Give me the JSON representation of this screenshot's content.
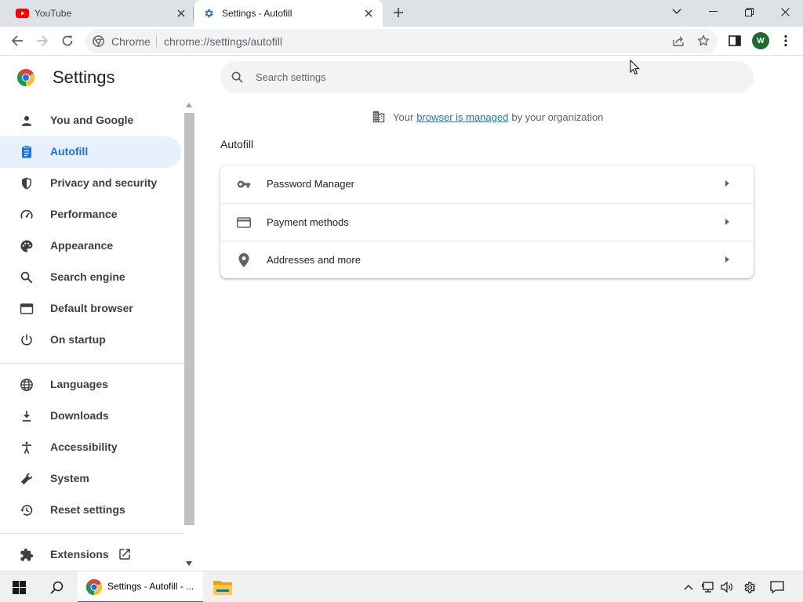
{
  "tabs": [
    {
      "title": "YouTube",
      "icon": "youtube-icon"
    },
    {
      "title": "Settings - Autofill",
      "icon": "gear-icon"
    }
  ],
  "toolbar": {
    "site_label": "Chrome",
    "url": "chrome://settings/autofill",
    "avatar_initial": "W"
  },
  "header": {
    "title": "Settings",
    "search_placeholder": "Search settings"
  },
  "sidebar": {
    "items": [
      {
        "label": "You and Google",
        "icon": "person-icon"
      },
      {
        "label": "Autofill",
        "icon": "clipboard-icon",
        "active": true
      },
      {
        "label": "Privacy and security",
        "icon": "shield-icon"
      },
      {
        "label": "Performance",
        "icon": "speedometer-icon"
      },
      {
        "label": "Appearance",
        "icon": "palette-icon"
      },
      {
        "label": "Search engine",
        "icon": "search-icon"
      },
      {
        "label": "Default browser",
        "icon": "browser-window-icon"
      },
      {
        "label": "On startup",
        "icon": "power-icon"
      },
      {
        "label": "Languages",
        "icon": "globe-icon"
      },
      {
        "label": "Downloads",
        "icon": "download-icon"
      },
      {
        "label": "Accessibility",
        "icon": "accessibility-icon"
      },
      {
        "label": "System",
        "icon": "wrench-icon"
      },
      {
        "label": "Reset settings",
        "icon": "history-icon"
      },
      {
        "label": "Extensions",
        "icon": "puzzle-icon"
      }
    ]
  },
  "main": {
    "managed_prefix": "Your",
    "managed_link": "browser is managed",
    "managed_suffix": "by your organization",
    "section_title": "Autofill",
    "rows": [
      {
        "label": "Password Manager",
        "icon": "key-icon"
      },
      {
        "label": "Payment methods",
        "icon": "credit-card-icon"
      },
      {
        "label": "Addresses and more",
        "icon": "location-pin-icon"
      }
    ]
  },
  "taskbar": {
    "active_window": "Settings - Autofill - ..."
  },
  "colors": {
    "accent": "#1a73e8",
    "active_bg": "#e8f0fe",
    "tabstrip_bg": "#dee1e6"
  }
}
